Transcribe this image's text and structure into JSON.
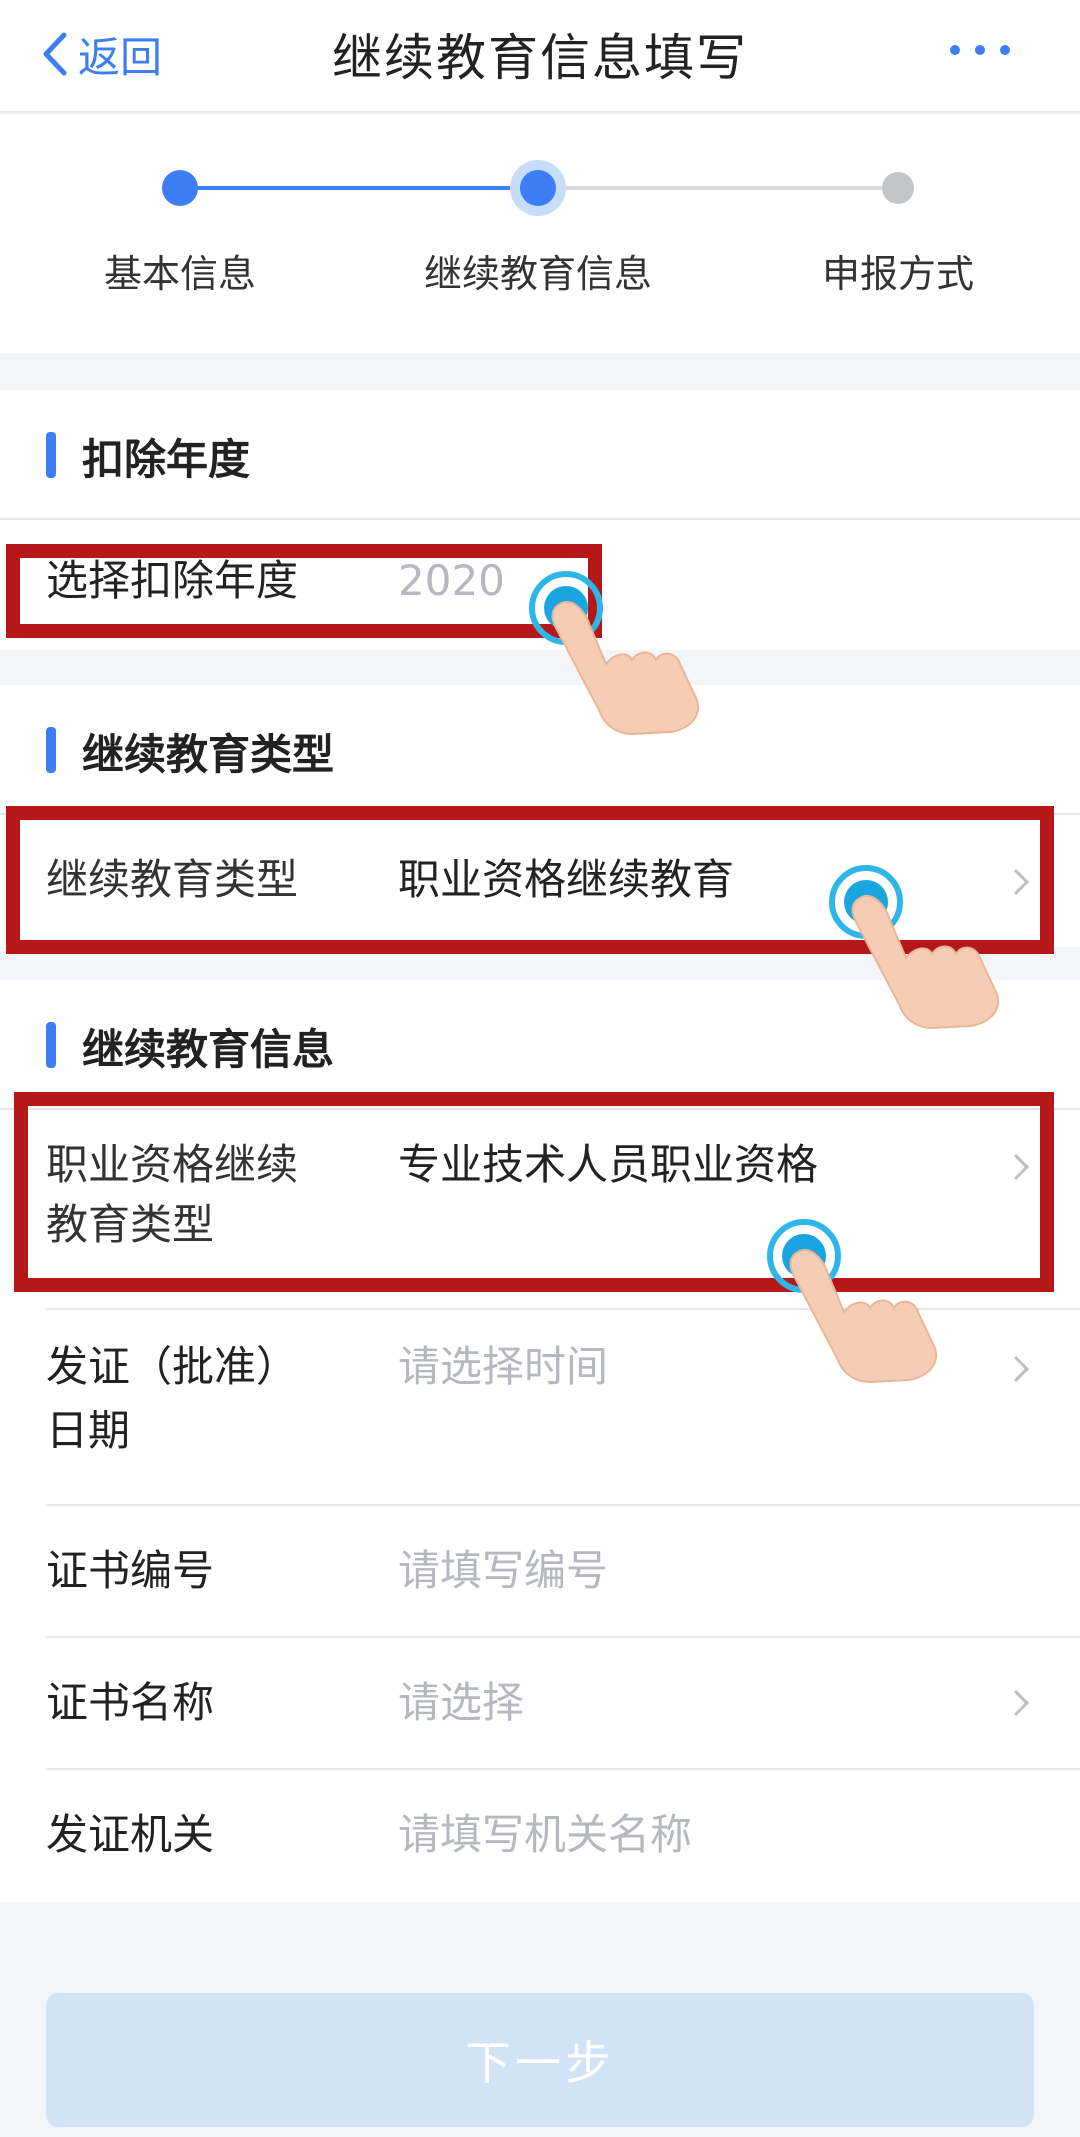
{
  "nav": {
    "back_label": "返回",
    "title": "继续教育信息填写"
  },
  "stepper": {
    "steps": [
      {
        "label": "基本信息",
        "state": "done"
      },
      {
        "label": "继续教育信息",
        "state": "current"
      },
      {
        "label": "申报方式",
        "state": "pending"
      }
    ]
  },
  "sections": {
    "year": {
      "title": "扣除年度",
      "row": {
        "label": "选择扣除年度",
        "value": "2020"
      }
    },
    "type": {
      "title": "继续教育类型",
      "row": {
        "label": "继续教育类型",
        "value": "职业资格继续教育"
      }
    },
    "info": {
      "title": "继续教育信息",
      "rows": [
        {
          "label_line1": "职业资格继续",
          "label_line2": "教育类型",
          "value": "专业技术人员职业资格"
        },
        {
          "label_line1": "发证（批准）",
          "label_line2": "日期",
          "placeholder": "请选择时间"
        },
        {
          "label": "证书编号",
          "placeholder": "请填写编号"
        },
        {
          "label": "证书名称",
          "placeholder": "请选择"
        },
        {
          "label": "发证机关",
          "placeholder": "请填写机关名称"
        }
      ]
    }
  },
  "next_button": "下一步",
  "colors": {
    "accent": "#3d7ef5",
    "highlight_border": "#b41818",
    "placeholder": "#b6b8bf",
    "disabled_button": "#d2e3f6"
  },
  "icons": [
    "chevron-left-icon",
    "more-icon",
    "chevron-right-icon",
    "pointing-hand-icon"
  ]
}
